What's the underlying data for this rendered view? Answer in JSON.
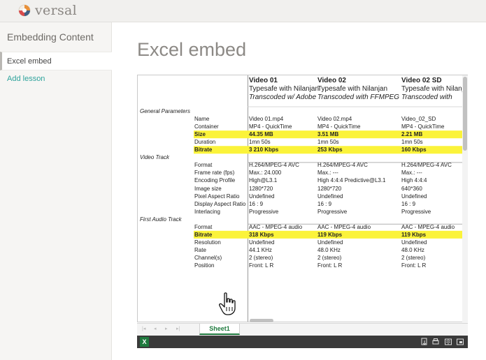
{
  "app": {
    "brand": "versal"
  },
  "sidebar": {
    "title": "Embedding Content",
    "items": [
      {
        "label": "Excel embed",
        "active": true
      }
    ],
    "add_label": "Add lesson"
  },
  "main": {
    "title": "Excel embed"
  },
  "sheet": {
    "columns": [
      {
        "title": "Video 01",
        "line2": "Typesafe with Nilanjan",
        "line3": "Transcoded w/ Adobe"
      },
      {
        "title": "Video 02",
        "line2": "Typesafe with Nilanjan",
        "line3": "Transcoded with FFMPEG"
      },
      {
        "title": "Video 02 SD",
        "line2": "Typesafe with Nilanja",
        "line3": "Transcoded with"
      }
    ],
    "rows": [
      {
        "section": "General Parameters",
        "label": "",
        "values": [
          "",
          "",
          ""
        ],
        "highlight": false
      },
      {
        "section": "",
        "label": "Name",
        "values": [
          "Video 01.mp4",
          "Video 02.mp4",
          "Video_02_SD"
        ],
        "highlight": false
      },
      {
        "section": "",
        "label": "Container",
        "values": [
          "MP4 - QuickTime",
          "MP4 - QuickTime",
          "MP4 - QuickTime"
        ],
        "highlight": false
      },
      {
        "section": "",
        "label": "Size",
        "values": [
          "44.35 MB",
          "3.51 MB",
          "2.21 MB"
        ],
        "highlight": true
      },
      {
        "section": "",
        "label": "Duration",
        "values": [
          "1mn 50s",
          "1mn 50s",
          "1mn 50s"
        ],
        "highlight": false
      },
      {
        "section": "",
        "label": "Bitrate",
        "values": [
          "3 210 Kbps",
          "253 Kbps",
          "160 Kbps"
        ],
        "highlight": true
      },
      {
        "section": "Video Track",
        "label": "",
        "values": [
          "",
          "",
          ""
        ],
        "highlight": false
      },
      {
        "section": "",
        "label": "Format",
        "values": [
          "H.264/MPEG-4 AVC",
          "H.264/MPEG-4 AVC",
          "H.264/MPEG-4 AVC"
        ],
        "highlight": false
      },
      {
        "section": "",
        "label": "Frame rate (fps)",
        "values": [
          "Max.: 24.000",
          "Max.: ---",
          "Max.: ---"
        ],
        "highlight": false
      },
      {
        "section": "",
        "label": "Encoding Profile",
        "values": [
          "High@L3.1",
          "High 4:4:4 Predictive@L3.1",
          "High 4:4:4"
        ],
        "highlight": false
      },
      {
        "section": "",
        "label": "Image size",
        "values": [
          "1280*720",
          "1280*720",
          "640*360"
        ],
        "highlight": false
      },
      {
        "section": "",
        "label": "Pixel Aspect Ratio",
        "values": [
          "Undefined",
          "Undefined",
          "Undefined"
        ],
        "highlight": false
      },
      {
        "section": "",
        "label": "Display Aspect Ratio",
        "values": [
          "16 : 9",
          "16 : 9",
          "16 : 9"
        ],
        "highlight": false
      },
      {
        "section": "",
        "label": "Interlacing",
        "values": [
          "Progressive",
          "Progressive",
          "Progressive"
        ],
        "highlight": false
      },
      {
        "section": "First Audio Track",
        "label": "",
        "values": [
          "",
          "",
          ""
        ],
        "highlight": false
      },
      {
        "section": "",
        "label": "Format",
        "values": [
          "AAC - MPEG-4 audio",
          "AAC - MPEG-4 audio",
          "AAC - MPEG-4 audio"
        ],
        "highlight": false
      },
      {
        "section": "",
        "label": "Bitrate",
        "values": [
          "318 Kbps",
          "119 Kbps",
          "119 Kbps"
        ],
        "highlight": true
      },
      {
        "section": "",
        "label": "Resolution",
        "values": [
          "Undefined",
          "Undefined",
          "Undefined"
        ],
        "highlight": false
      },
      {
        "section": "",
        "label": "Rate",
        "values": [
          "44.1 KHz",
          "48.0 KHz",
          "48.0 KHz"
        ],
        "highlight": false
      },
      {
        "section": "",
        "label": "Channel(s)",
        "values": [
          "2 (stereo)",
          " 2 (stereo)",
          " 2 (stereo)"
        ],
        "highlight": false
      },
      {
        "section": "",
        "label": "Position",
        "values": [
          "Front: L R",
          "Front: L R",
          "Front: L R"
        ],
        "highlight": false
      }
    ],
    "tab_label": "Sheet1",
    "excel_badge": "X",
    "highlight_color": "#fbf33a"
  },
  "icons": {
    "logo": "versal-logo-icon",
    "cursor": "hand-pointer-icon",
    "statusbar": [
      "download-icon",
      "print-icon",
      "reader-view-icon",
      "fullscreen-icon"
    ]
  }
}
